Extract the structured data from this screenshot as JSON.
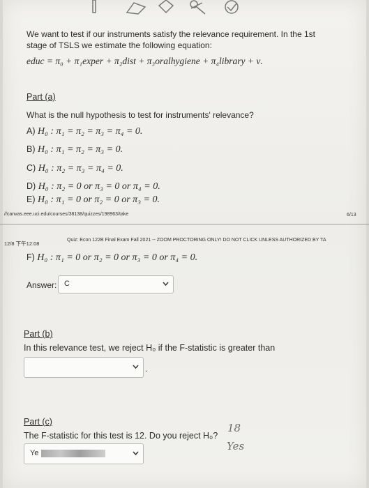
{
  "intro": {
    "line1": "We want to test if our instruments satisfy the relevance requirement. In the 1st",
    "line2": "stage of TSLS we estimate the following equation:",
    "equation": "educ = π₀ + π₁exper + π₂dist + π₃oralhygiene + π₄library + ν."
  },
  "part_a": {
    "heading": "Part (a)",
    "question": "What is the null hypothesis to test for instruments' relevance?",
    "options": [
      {
        "letter": "A)",
        "text": "H₀ : π₁ = π₂ = π₃ = π₄ = 0."
      },
      {
        "letter": "B)",
        "text": "H₀ : π₁ = π₂ = π₃ = 0."
      },
      {
        "letter": "C)",
        "text": "H₀ : π₂ = π₃ = π₄ = 0."
      },
      {
        "letter": "D)",
        "text": "H₀ : π₂ = 0 or π₃ = 0 or π₄ = 0."
      },
      {
        "letter": "E)",
        "text": "H₀ : π₁ = 0 or π₂ = 0 or π₃ = 0."
      },
      {
        "letter": "F)",
        "text": "H₀ : π₁ = 0 or π₂ = 0 or π₃ = 0 or π₄ = 0."
      }
    ],
    "answer_label": "Answer:",
    "answer_value": "C"
  },
  "footer_page1": {
    "url": "//canvas.eee.uci.edu/courses/38138/quizzes/198963/take",
    "page": "6/13"
  },
  "header_page2": {
    "time": "12/8 下午12:08",
    "title": "Quiz: Econ 122B Final Exam Fall 2021 -- ZOOM PROCTORING ONLY! DO NOT CLICK UNLESS AUTHORIZED BY TA"
  },
  "part_b": {
    "heading": "Part (b)",
    "question": "In this relevance test, we reject H₀ if the F-statistic is greater than",
    "select_value": "",
    "trailing_period": "."
  },
  "part_c": {
    "heading": "Part (c)",
    "question": "The F-statistic for this test is 12. Do you reject H₀?",
    "select_value": "Ye",
    "handwritten_number": "18",
    "handwritten_answer": "Yes"
  }
}
